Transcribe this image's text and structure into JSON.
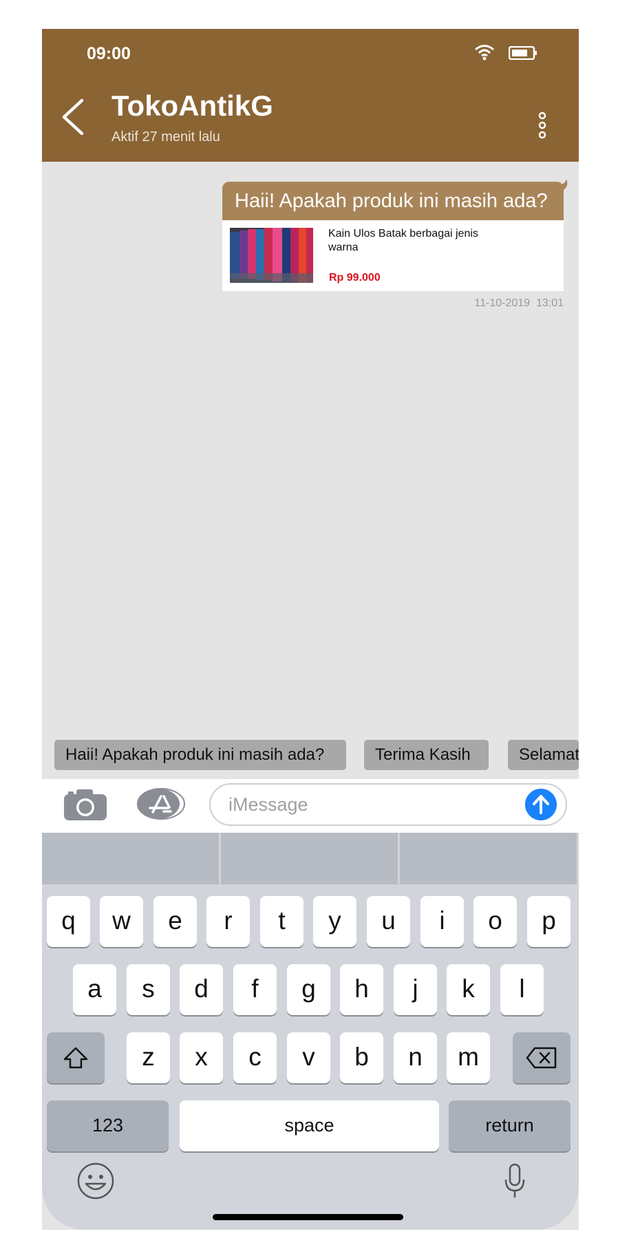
{
  "status_bar": {
    "time": "09:00"
  },
  "header": {
    "title": "TokoAntikG",
    "subtitle": "Aktif 27 menit lalu"
  },
  "message": {
    "text": "Haii! Apakah produk ini masih ada?",
    "product_name": "Kain Ulos Batak berbagai jenis warna",
    "product_price": "Rp 99.000",
    "timestamp": "11-10-2019  13:01"
  },
  "quick_replies": [
    "Haii! Apakah produk ini masih ada?",
    "Terima Kasih",
    "Selamat"
  ],
  "input": {
    "placeholder": "iMessage"
  },
  "keyboard": {
    "row1": [
      "q",
      "w",
      "e",
      "r",
      "t",
      "y",
      "u",
      "i",
      "o",
      "p"
    ],
    "row2": [
      "a",
      "s",
      "d",
      "f",
      "g",
      "h",
      "j",
      "k",
      "l"
    ],
    "row3": [
      "z",
      "x",
      "c",
      "v",
      "b",
      "n",
      "m"
    ],
    "numbers_label": "123",
    "space_label": "space",
    "return_label": "return"
  },
  "colors": {
    "header": "#8b6434",
    "bubble": "#a88559",
    "price": "#e0141d",
    "send": "#1a82fb"
  },
  "icons": [
    "wifi-icon",
    "battery-icon",
    "back-icon",
    "more-icon",
    "camera-icon",
    "app-store-icon",
    "send-icon",
    "shift-icon",
    "backspace-icon",
    "emoji-icon",
    "microphone-icon"
  ]
}
